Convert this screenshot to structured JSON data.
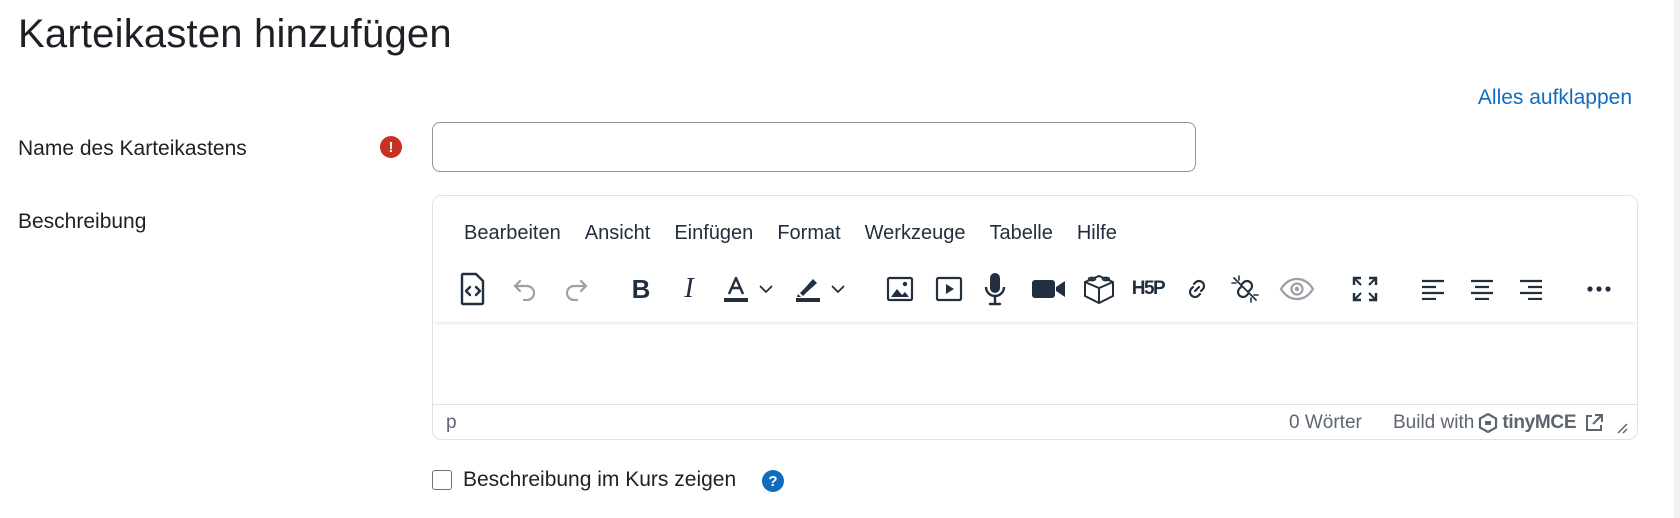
{
  "page": {
    "title": "Karteikasten hinzufügen",
    "expand_all": "Alles aufklappen"
  },
  "fields": {
    "name": {
      "label": "Name des Karteikastens",
      "value": "",
      "required_icon": "exclamation-icon"
    },
    "description": {
      "label": "Beschreibung"
    }
  },
  "editor": {
    "menu": [
      "Bearbeiten",
      "Ansicht",
      "Einfügen",
      "Format",
      "Werkzeuge",
      "Tabelle",
      "Hilfe"
    ],
    "toolbar_icons": [
      "source-code-icon",
      "undo-icon",
      "redo-icon",
      "bold-icon",
      "italic-icon",
      "text-color-icon",
      "highlight-color-icon",
      "image-icon",
      "media-icon",
      "record-audio-icon",
      "record-video-icon",
      "content-bank-icon",
      "h5p-icon",
      "link-icon",
      "unlink-icon",
      "accessibility-checker-icon",
      "fullscreen-icon",
      "align-left-icon",
      "align-center-icon",
      "align-right-icon",
      "more-icon"
    ],
    "h5p_label": "H5P",
    "status": {
      "path": "p",
      "words": "0 Wörter",
      "build_with": "Build with",
      "brand": "tinyMCE"
    }
  },
  "show_description": {
    "label": "Beschreibung im Kurs zeigen",
    "checked": false
  },
  "colors": {
    "link": "#0f6cbf",
    "required": "#ca3120",
    "help": "#0f6cbf",
    "text": "#1d2125",
    "toolbar_icon": "#222f3e"
  }
}
